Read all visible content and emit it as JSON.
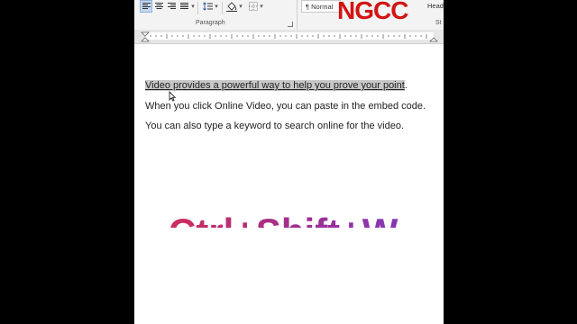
{
  "ribbon": {
    "paragraph_group_label": "Paragraph",
    "styles_group_label": "St",
    "style_normal": "¶ Normal",
    "style_heading": "Head",
    "icons": [
      "align-left-icon",
      "align-center-icon",
      "align-right-icon",
      "justify-icon",
      "line-spacing-icon",
      "shading-icon",
      "borders-icon"
    ]
  },
  "logo": {
    "text": "NGCC",
    "color": "#d21414"
  },
  "document": {
    "line1_selected": "Video provides a powerful way to help you prove your point",
    "line1_tail": ".",
    "line2": "When you click Online Video, you can paste in the embed code.",
    "line3": "You can also type a keyword to search online for the video."
  },
  "overlay": {
    "shortcut_text": "Ctrl+Shift+W"
  }
}
